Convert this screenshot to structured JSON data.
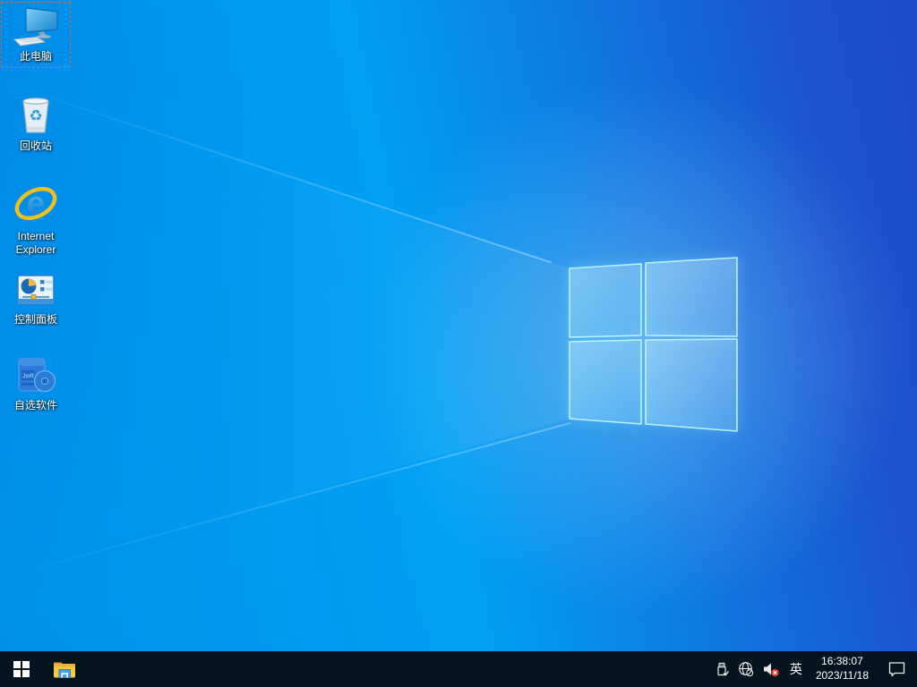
{
  "wallpaper": {
    "base_left_color": "#00a0f5",
    "base_right_color": "#1d4bce",
    "logo_edge_color": "#bdeffc"
  },
  "desktop": {
    "icons": [
      {
        "id": "this-pc",
        "label": "此电脑",
        "selected": true
      },
      {
        "id": "recycle-bin",
        "label": "回收站",
        "selected": false,
        "recycle_glyph": "♻"
      },
      {
        "id": "internet-explorer",
        "label": "Internet Explorer",
        "selected": false,
        "letter": "e"
      },
      {
        "id": "control-panel",
        "label": "控制面板",
        "selected": false
      },
      {
        "id": "custom-software",
        "label": "自选软件",
        "selected": false,
        "box_text": "JoR"
      }
    ]
  },
  "taskbar": {
    "background_color": "#03141f",
    "start_icon": "windows-logo",
    "pinned_icons": [
      "file-explorer"
    ],
    "tray": {
      "status_icons": [
        "usb-device",
        "network-globe-offline",
        "volume-muted"
      ],
      "ime_label": "英",
      "clock": {
        "time": "16:38:07",
        "date": "2023/11/18"
      },
      "action_center_icon": "notification-bubble"
    }
  }
}
